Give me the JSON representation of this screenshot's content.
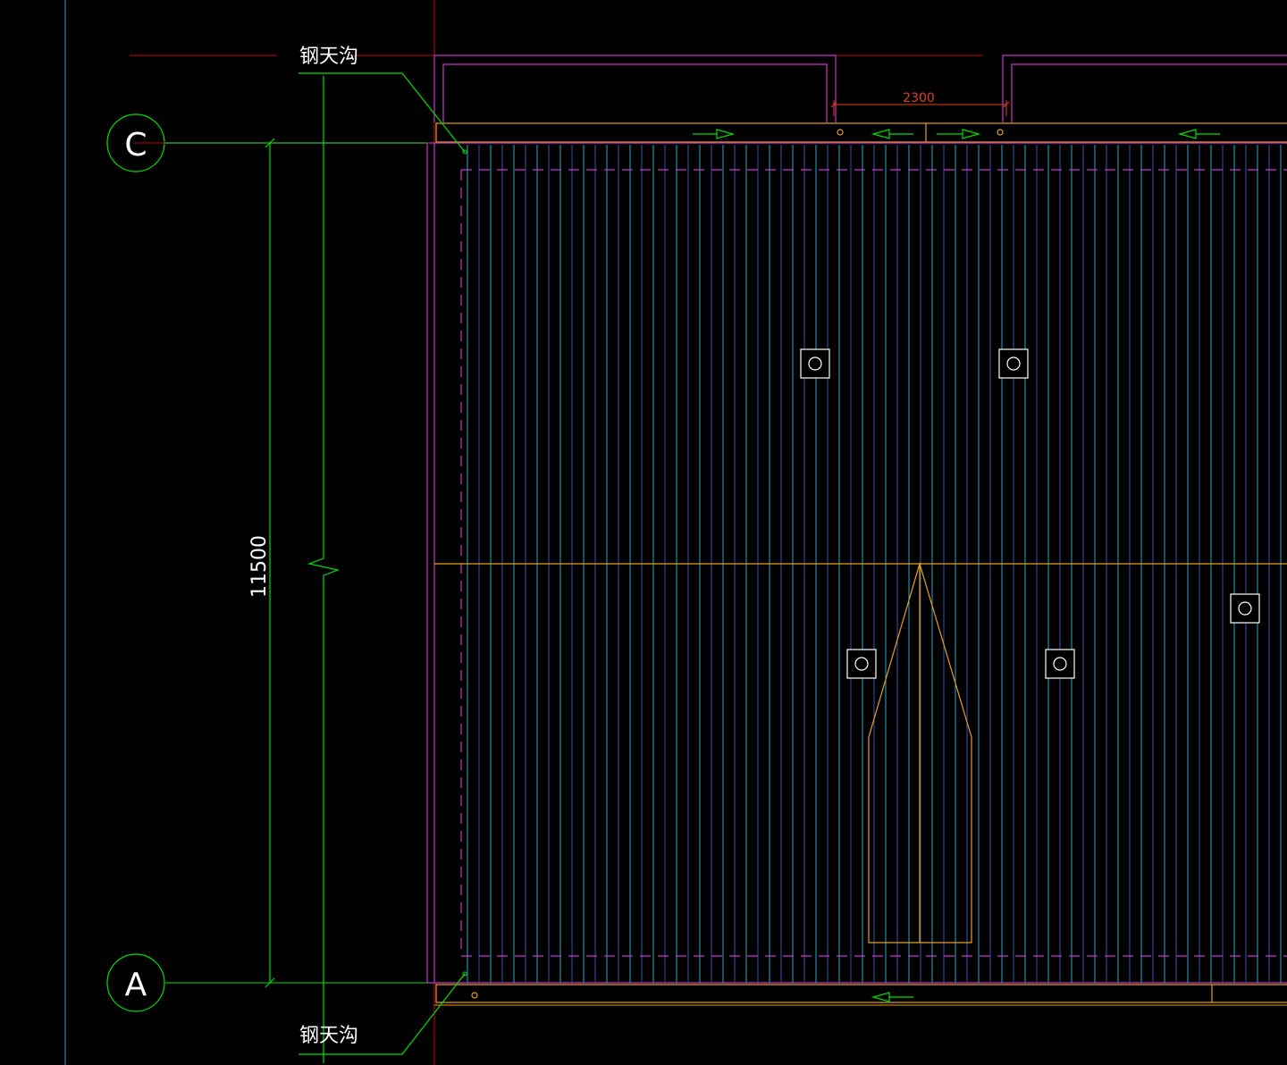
{
  "drawing": {
    "top_gutter_label": "钢天沟",
    "bottom_gutter_label": "钢天沟",
    "grid_axis_top": "C",
    "grid_axis_bottom": "A",
    "overall_dimension": "11500",
    "opening_dimension": "2300"
  },
  "colors": {
    "background": "#000000",
    "grid_line_red": "#d00000",
    "cyan_line": "#22aacc",
    "dimension_green": "#00e000",
    "gutter_orange": "#e8a020",
    "outline_magenta": "#cc33cc",
    "text_white": "#ffffff",
    "dimension_text_red": "#e04020"
  },
  "icons": {
    "flow_arrow": "arrow-icon",
    "roof_drain": "drain-icon"
  }
}
